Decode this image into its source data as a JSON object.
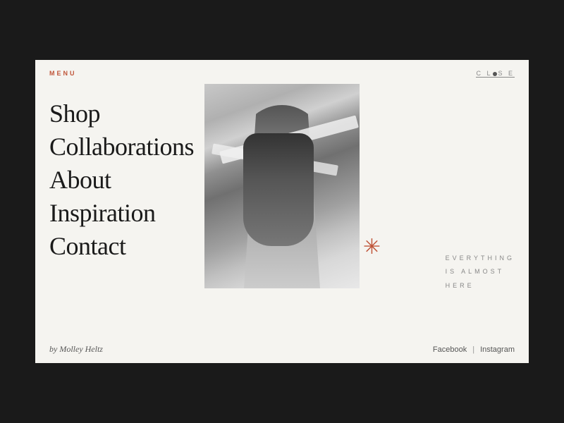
{
  "header": {
    "menu_label": "MENU",
    "close_label": "CLOSE"
  },
  "nav": {
    "items": [
      {
        "label": "Shop",
        "id": "shop"
      },
      {
        "label": "Collaborations",
        "id": "collaborations"
      },
      {
        "label": "About",
        "id": "about"
      },
      {
        "label": "Inspiration",
        "id": "inspiration"
      },
      {
        "label": "Contact",
        "id": "contact"
      }
    ]
  },
  "tagline": {
    "line1": "EVERYTHING",
    "line2": "IS  ALMOST",
    "line3": "HERE"
  },
  "footer": {
    "byline": "by Molley Heltz",
    "social1": "Facebook",
    "social_sep": "|",
    "social2": "Instagram"
  },
  "colors": {
    "accent": "#c0563a",
    "bg": "#f5f4f0",
    "text_dark": "#1a1a1a",
    "text_muted": "#888"
  }
}
